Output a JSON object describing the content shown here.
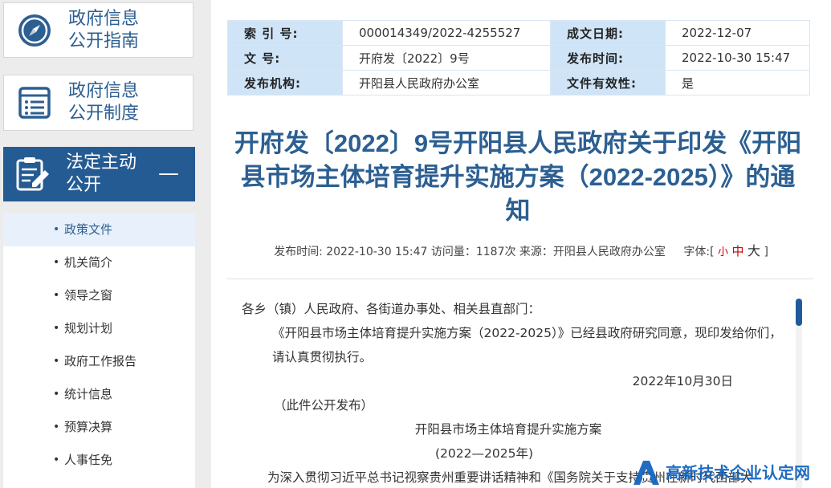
{
  "sidebar": {
    "guide_label_1": "政府信息",
    "guide_label_2": "公开指南",
    "system_label_1": "政府信息",
    "system_label_2": "公开制度",
    "active_label_1": "法定主动",
    "active_label_2": "公开",
    "collapse_symbol": "—",
    "items": [
      {
        "label": "政策文件"
      },
      {
        "label": "机关简介"
      },
      {
        "label": "领导之窗"
      },
      {
        "label": "规划计划"
      },
      {
        "label": "政府工作报告"
      },
      {
        "label": "统计信息"
      },
      {
        "label": "预算决算"
      },
      {
        "label": "人事任免"
      }
    ],
    "bullet": "•"
  },
  "meta": {
    "index_key": "索 引 号:",
    "index_val": "000014349/2022-4255527",
    "date_key": "成文日期:",
    "date_val": "2022-12-07",
    "docno_key": "文 号:",
    "docno_val": "开府发〔2022〕9号",
    "pubtime_key": "发布时间:",
    "pubtime_val": "2022-10-30 15:47",
    "org_key": "发布机构:",
    "org_val": "开阳县人民政府办公室",
    "valid_key": "文件有效性:",
    "valid_val": "是"
  },
  "article": {
    "title": "开府发〔2022〕9号开阳县人民政府关于印发《开阳县市场主体培育提升实施方案（2022-2025）》的通知",
    "info_prefix": "发布时间: 2022-10-30 15:47 访问量：1187次 来源：开阳县人民政府办公室",
    "font_label": "字体:[",
    "font_small": "小",
    "font_medium": "中",
    "font_large": "大",
    "font_close": "]",
    "p1": "各乡（镇）人民政府、各街道办事处、相关县直部门：",
    "p2": "《开阳县市场主体培育提升实施方案（2022-2025）》已经县政府研究同意，现印发给你们，请认真贯彻执行。",
    "p3": "2022年10月30日",
    "p4": "（此件公开发布）",
    "p5": "开阳县市场主体培育提升实施方案",
    "p6": "(2022—2025年)",
    "p7": "为深入贯彻习近平总书记视察贵州重要讲话精神和《国务院关于支持贵州在新时代西部大"
  },
  "watermark": {
    "text": "高新技术企业认定网"
  },
  "colors": {
    "accent": "#2c5f92",
    "sidebar_active": "#255b93",
    "table_key_bg": "#cfe4f7"
  }
}
